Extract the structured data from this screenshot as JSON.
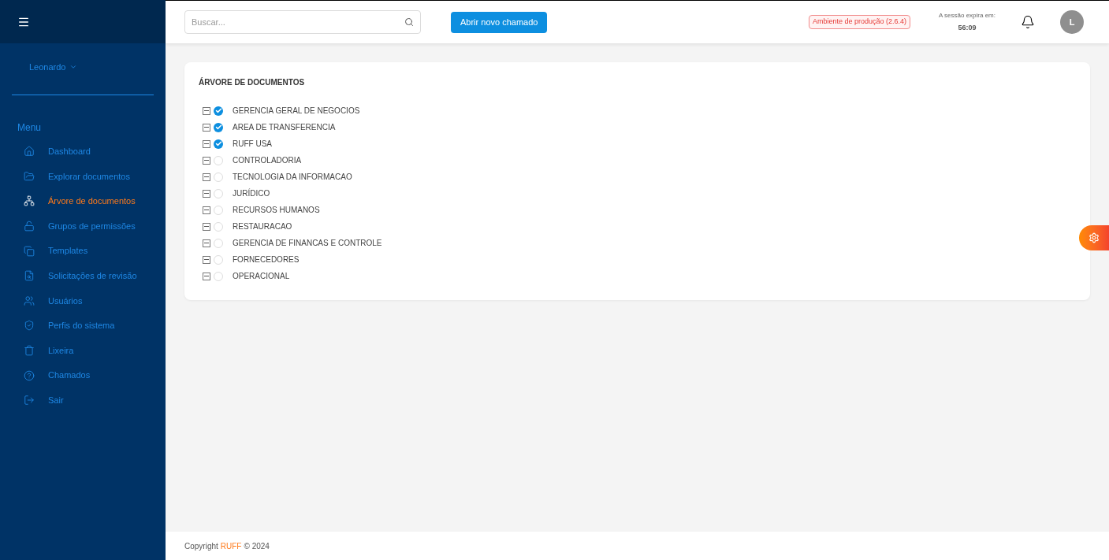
{
  "topbar": {
    "search": {
      "placeholder": "Buscar..."
    },
    "new_ticket_button": "Abrir novo chamado",
    "environment_badge": "Ambiente de produção (2.6.4)",
    "session_label": "A sessão expira em:",
    "session_time": "56:09",
    "avatar_initial": "L"
  },
  "sidebar": {
    "user": "Leonardo",
    "section": "Menu",
    "items": [
      {
        "label": "Dashboard",
        "selected": false
      },
      {
        "label": "Explorar documentos",
        "selected": false
      },
      {
        "label": "Árvore de documentos",
        "selected": true
      },
      {
        "label": "Grupos de permissões",
        "selected": false
      },
      {
        "label": "Templates",
        "selected": false
      },
      {
        "label": "Solicitações de revisão",
        "selected": false
      },
      {
        "label": "Usuários",
        "selected": false
      },
      {
        "label": "Perfis do sistema",
        "selected": false
      },
      {
        "label": "Lixeira",
        "selected": false
      },
      {
        "label": "Chamados",
        "selected": false
      },
      {
        "label": "Sair",
        "selected": false
      }
    ]
  },
  "tree": {
    "title": "ÁRVORE DE DOCUMENTOS",
    "nodes": [
      {
        "label": "GERENCIA GERAL DE NEGOCIOS",
        "expanded": true,
        "checked": true
      },
      {
        "label": "AREA DE TRANSFERENCIA",
        "expanded": true,
        "checked": true
      },
      {
        "label": "RUFF USA",
        "expanded": true,
        "checked": true
      },
      {
        "label": "CONTROLADORIA",
        "expanded": true,
        "checked": false
      },
      {
        "label": "TECNOLOGIA DA INFORMACAO",
        "expanded": true,
        "checked": false
      },
      {
        "label": "JURÍDICO",
        "expanded": true,
        "checked": false
      },
      {
        "label": "RECURSOS HUMANOS",
        "expanded": true,
        "checked": false
      },
      {
        "label": "RESTAURACAO",
        "expanded": true,
        "checked": false
      },
      {
        "label": "GERENCIA DE FINANCAS E CONTROLE",
        "expanded": true,
        "checked": false
      },
      {
        "label": "FORNECEDORES",
        "expanded": true,
        "checked": false
      },
      {
        "label": "OPERACIONAL",
        "expanded": true,
        "checked": false
      }
    ]
  },
  "footer": {
    "prefix": "Copyright",
    "brand": "RUFF",
    "suffix": "© 2024"
  }
}
